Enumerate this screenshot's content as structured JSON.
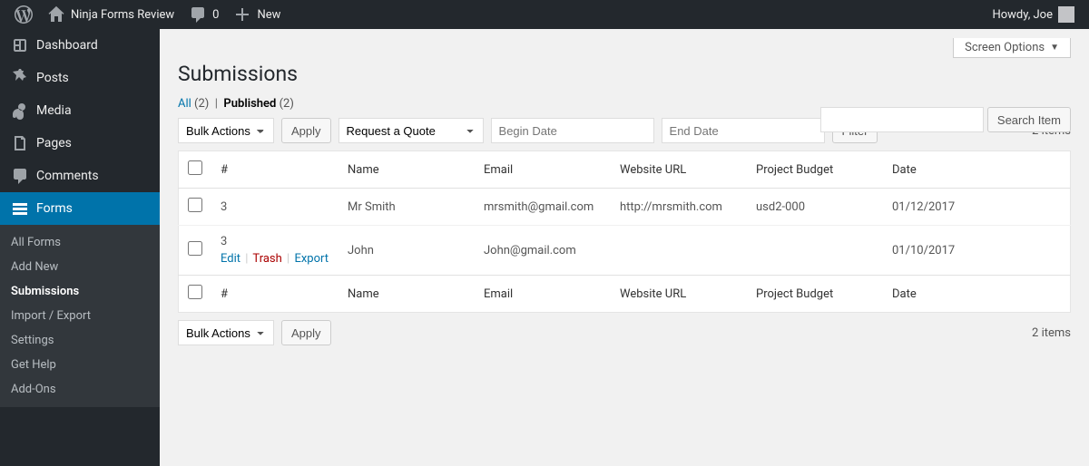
{
  "adminbar": {
    "site_title": "Ninja Forms Review",
    "comments_count": "0",
    "new_label": "New",
    "howdy": "Howdy, Joe"
  },
  "sidebar": {
    "items": [
      {
        "label": "Dashboard"
      },
      {
        "label": "Posts"
      },
      {
        "label": "Media"
      },
      {
        "label": "Pages"
      },
      {
        "label": "Comments"
      },
      {
        "label": "Forms"
      }
    ],
    "submenu": [
      {
        "label": "All Forms"
      },
      {
        "label": "Add New"
      },
      {
        "label": "Submissions"
      },
      {
        "label": "Import / Export"
      },
      {
        "label": "Settings"
      },
      {
        "label": "Get Help"
      },
      {
        "label": "Add-Ons"
      }
    ]
  },
  "screen_options_label": "Screen Options",
  "page_title": "Submissions",
  "filters": {
    "all_label": "All",
    "all_count": "(2)",
    "published_label": "Published",
    "published_count": "(2)"
  },
  "search": {
    "button": "Search Item"
  },
  "tablenav": {
    "bulk_label": "Bulk Actions",
    "apply": "Apply",
    "form_select": "Request a Quote",
    "begin_placeholder": "Begin Date",
    "end_placeholder": "End Date",
    "filter": "Filter",
    "items_count": "2 items"
  },
  "table": {
    "cols": {
      "id": "#",
      "name": "Name",
      "email": "Email",
      "url": "Website URL",
      "budget": "Project Budget",
      "date": "Date"
    },
    "rows": [
      {
        "id": "3",
        "name": "Mr Smith",
        "email": "mrsmith@gmail.com",
        "url": "http://mrsmith.com",
        "budget": "usd2-000",
        "date": "01/12/2017"
      },
      {
        "id": "3",
        "name": "John",
        "email": "John@gmail.com",
        "url": "",
        "budget": "",
        "date": "01/10/2017"
      }
    ],
    "row_actions": {
      "edit": "Edit",
      "trash": "Trash",
      "export": "Export"
    }
  }
}
